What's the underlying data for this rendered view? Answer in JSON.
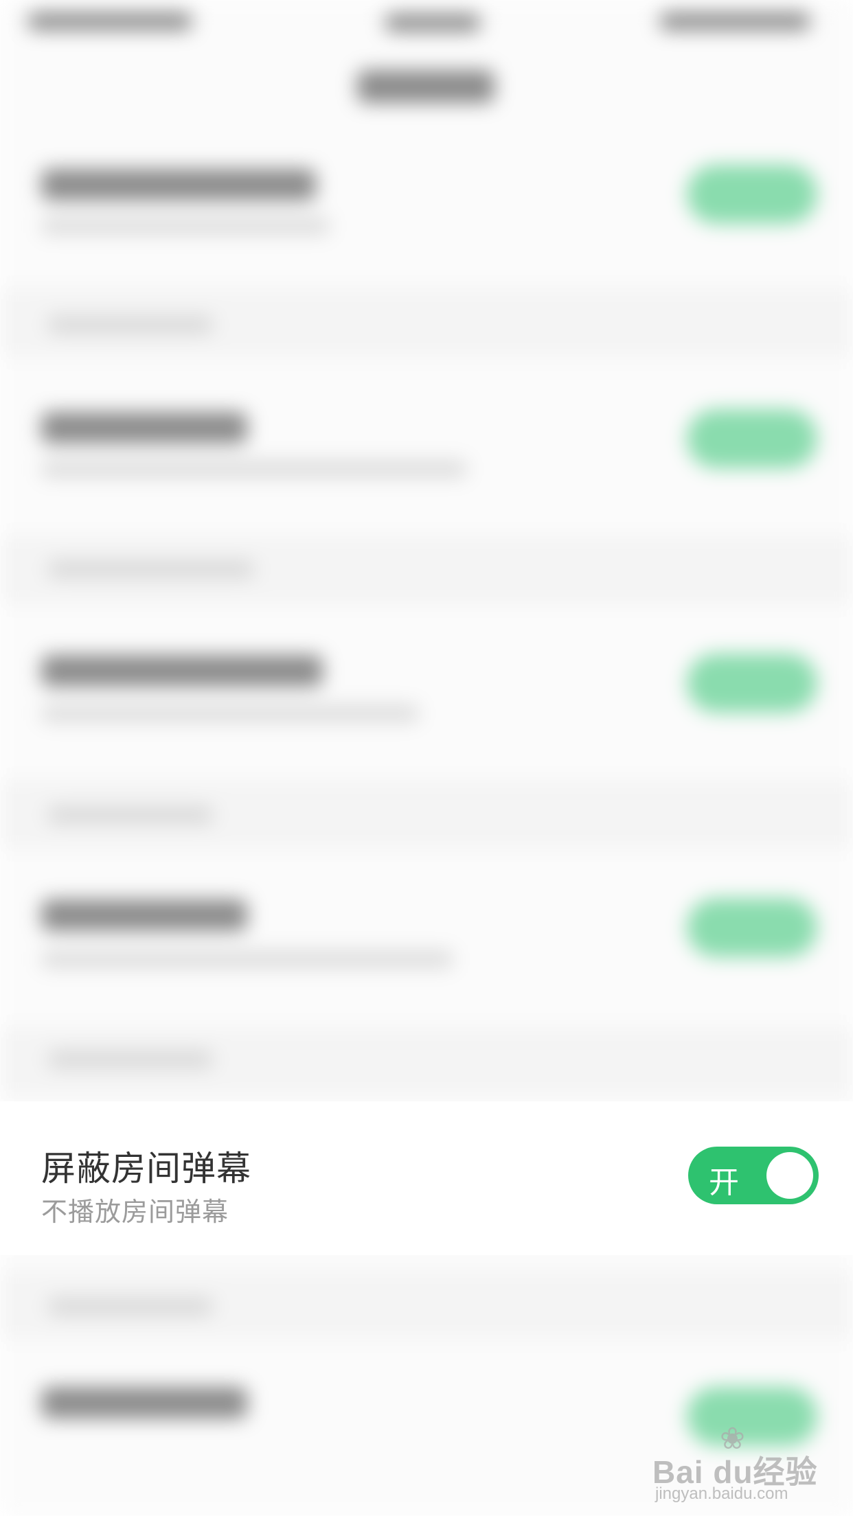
{
  "setting": {
    "title": "屏蔽房间弹幕",
    "subtitle": "不播放房间弹幕",
    "toggle_label": "开",
    "toggle_on": true
  },
  "colors": {
    "accent": "#2ec26f",
    "title": "#333333",
    "subtitle": "#9b9b9b"
  },
  "watermark": {
    "logo": "Bai du经验",
    "url": "jingyan.baidu.com"
  }
}
